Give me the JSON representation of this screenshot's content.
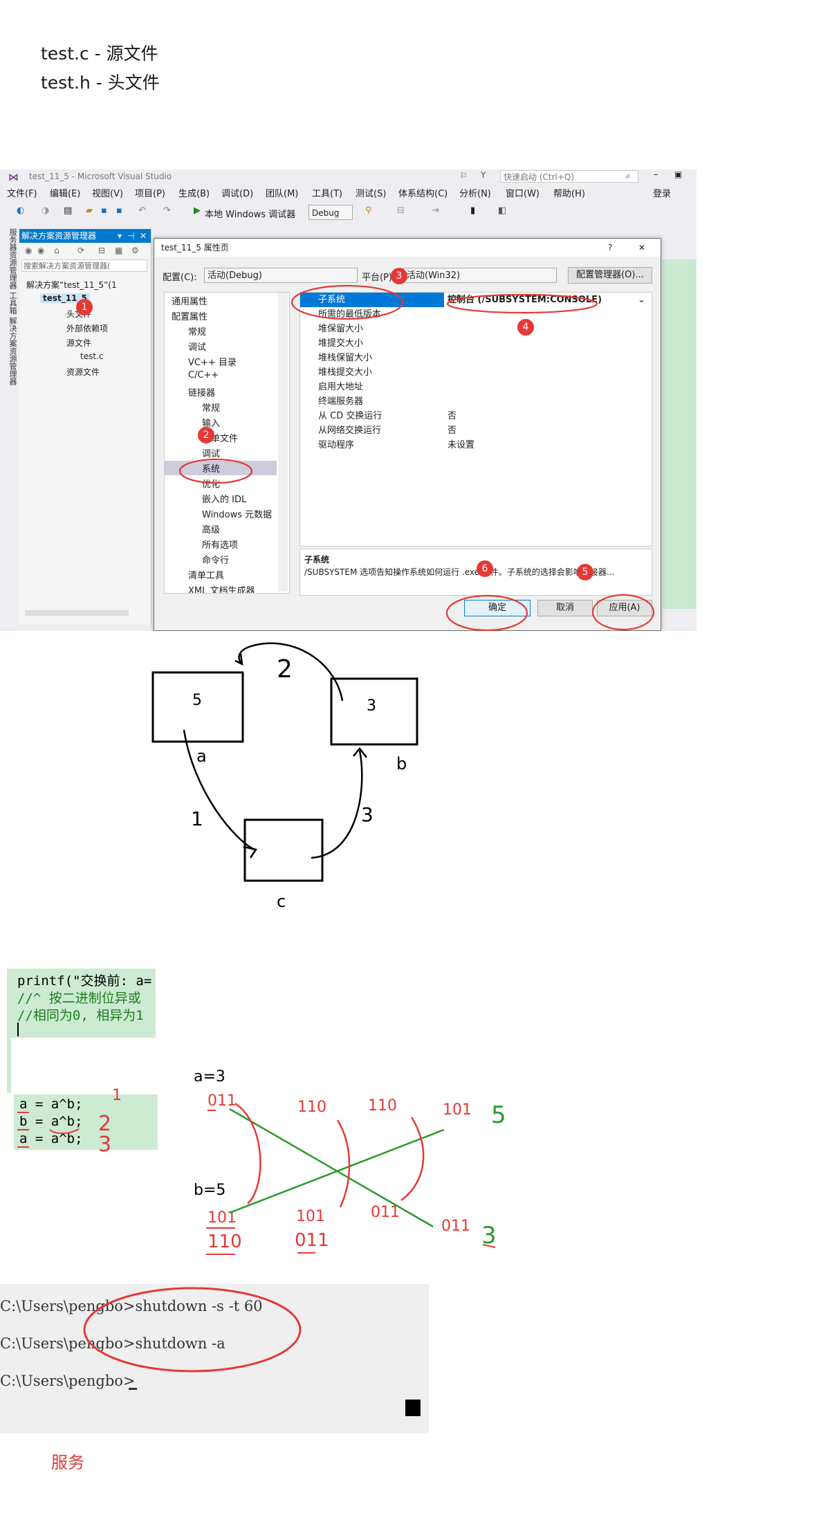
{
  "notes": {
    "line1": "test.c - 源文件",
    "line2": "test.h - 头文件",
    "footer": "服务"
  },
  "vs": {
    "title": "test_11_5 - Microsoft Visual Studio",
    "quick_launch_placeholder": "快速启动 (Ctrl+Q)",
    "login": "登录",
    "menu": [
      "文件(F)",
      "编辑(E)",
      "视图(V)",
      "项目(P)",
      "生成(B)",
      "调试(D)",
      "团队(M)",
      "工具(T)",
      "测试(S)",
      "体系结构(C)",
      "分析(N)",
      "窗口(W)",
      "帮助(H)"
    ],
    "toolbar": {
      "debugger": "本地 Windows 调试器",
      "config": "Debug"
    },
    "left_strip": "服务器资源管理器  工具箱  解决方案资源管理器",
    "solution_explorer": {
      "header": "解决方案资源管理器",
      "search_placeholder": "搜索解决方案资源管理器(",
      "items": [
        "解决方案“test_11_5”(1",
        "test_11_5",
        "头文件",
        "外部依赖项",
        "源文件",
        "test.c",
        "资源文件"
      ]
    },
    "dialog": {
      "title": "test_11_5 属性页",
      "help": "?",
      "close": "✕",
      "config_label": "配置(C):",
      "config_value": "活动(Debug)",
      "platform_label": "平台(P):",
      "platform_value": "活动(Win32)",
      "config_manager": "配置管理器(O)...",
      "tree": [
        "通用属性",
        "配置属性",
        "常规",
        "调试",
        "VC++ 目录",
        "C/C++",
        "链接器",
        "常规",
        "输入",
        "清单文件",
        "调试",
        "系统",
        "优化",
        "嵌入的 IDL",
        "Windows 元数据",
        "高级",
        "所有选项",
        "命令行",
        "清单工具",
        "XML 文档生成器"
      ],
      "props": [
        {
          "name": "子系统",
          "value": "控制台 (/SUBSYSTEM:CONSOLE)"
        },
        {
          "name": "所需的最低版本",
          "value": ""
        },
        {
          "name": "堆保留大小",
          "value": ""
        },
        {
          "name": "堆提交大小",
          "value": ""
        },
        {
          "name": "堆栈保留大小",
          "value": ""
        },
        {
          "name": "堆栈提交大小",
          "value": ""
        },
        {
          "name": "启用大地址",
          "value": ""
        },
        {
          "name": "终端服务器",
          "value": ""
        },
        {
          "name": "从 CD 交换运行",
          "value": "否"
        },
        {
          "name": "从网络交换运行",
          "value": "否"
        },
        {
          "name": "驱动程序",
          "value": "未设置"
        }
      ],
      "desc_title": "子系统",
      "desc_text": "/SUBSYSTEM 选项告知操作系统如何运行 .exe 文件。子系统的选择会影响链接器...",
      "ok": "确定",
      "cancel": "取消",
      "apply": "应用(A)"
    },
    "badges": [
      "1",
      "2",
      "3",
      "4",
      "5",
      "6"
    ]
  },
  "swap_diagram": {
    "box_a": "5",
    "box_b": "3",
    "box_c": "",
    "label_a": "a",
    "label_b": "b",
    "label_c": "c",
    "step1": "1",
    "step2": "2",
    "step3": "3"
  },
  "code1": {
    "line1": "printf(\"交换前: a=",
    "line2": "//^ 按二进制位异或",
    "line3": "//相同为0, 相异为1"
  },
  "code2": {
    "line1": "a = a^b;",
    "line2": "b = a^b;",
    "line3": "a = a^b;",
    "step1": "1",
    "step2": "2",
    "step3": "3"
  },
  "xor": {
    "a_label": "a=3",
    "b_label": "b=5",
    "a_bin": "011",
    "b_bin": "101",
    "col2_top": "110",
    "col2_bot": "101",
    "col3_top": "110",
    "col3_bot": "011",
    "col4_top": "101",
    "col4_bot": "011",
    "b_written": "110",
    "col2_written": "011",
    "result_top": "5",
    "result_bot": "3"
  },
  "console": {
    "line1": "C:\\Users\\pengbo>shutdown -s -t 60",
    "line2": "C:\\Users\\pengbo>shutdown -a",
    "line3": "C:\\Users\\pengbo>"
  }
}
